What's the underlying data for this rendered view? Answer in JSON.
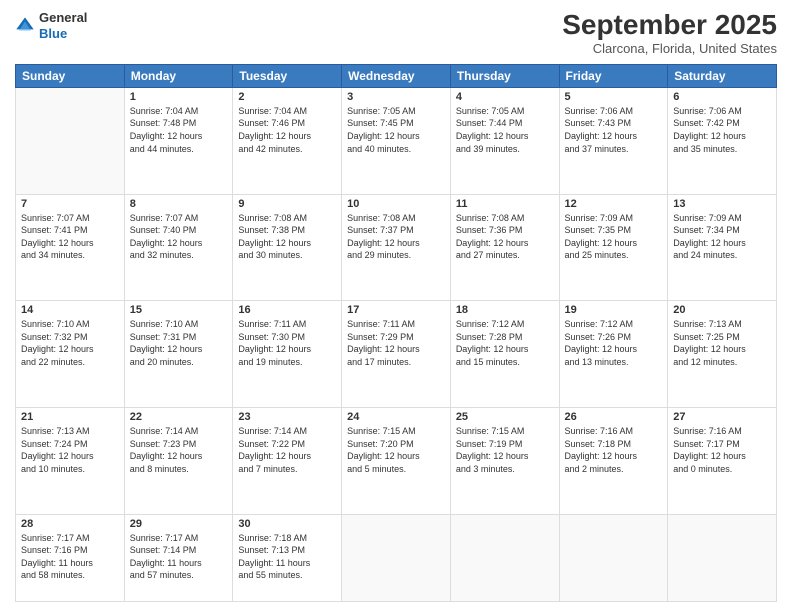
{
  "header": {
    "logo": {
      "general": "General",
      "blue": "Blue"
    },
    "title": "September 2025",
    "location": "Clarcona, Florida, United States"
  },
  "days_of_week": [
    "Sunday",
    "Monday",
    "Tuesday",
    "Wednesday",
    "Thursday",
    "Friday",
    "Saturday"
  ],
  "weeks": [
    [
      {
        "day": "",
        "info": ""
      },
      {
        "day": "1",
        "info": "Sunrise: 7:04 AM\nSunset: 7:48 PM\nDaylight: 12 hours\nand 44 minutes."
      },
      {
        "day": "2",
        "info": "Sunrise: 7:04 AM\nSunset: 7:46 PM\nDaylight: 12 hours\nand 42 minutes."
      },
      {
        "day": "3",
        "info": "Sunrise: 7:05 AM\nSunset: 7:45 PM\nDaylight: 12 hours\nand 40 minutes."
      },
      {
        "day": "4",
        "info": "Sunrise: 7:05 AM\nSunset: 7:44 PM\nDaylight: 12 hours\nand 39 minutes."
      },
      {
        "day": "5",
        "info": "Sunrise: 7:06 AM\nSunset: 7:43 PM\nDaylight: 12 hours\nand 37 minutes."
      },
      {
        "day": "6",
        "info": "Sunrise: 7:06 AM\nSunset: 7:42 PM\nDaylight: 12 hours\nand 35 minutes."
      }
    ],
    [
      {
        "day": "7",
        "info": "Sunrise: 7:07 AM\nSunset: 7:41 PM\nDaylight: 12 hours\nand 34 minutes."
      },
      {
        "day": "8",
        "info": "Sunrise: 7:07 AM\nSunset: 7:40 PM\nDaylight: 12 hours\nand 32 minutes."
      },
      {
        "day": "9",
        "info": "Sunrise: 7:08 AM\nSunset: 7:38 PM\nDaylight: 12 hours\nand 30 minutes."
      },
      {
        "day": "10",
        "info": "Sunrise: 7:08 AM\nSunset: 7:37 PM\nDaylight: 12 hours\nand 29 minutes."
      },
      {
        "day": "11",
        "info": "Sunrise: 7:08 AM\nSunset: 7:36 PM\nDaylight: 12 hours\nand 27 minutes."
      },
      {
        "day": "12",
        "info": "Sunrise: 7:09 AM\nSunset: 7:35 PM\nDaylight: 12 hours\nand 25 minutes."
      },
      {
        "day": "13",
        "info": "Sunrise: 7:09 AM\nSunset: 7:34 PM\nDaylight: 12 hours\nand 24 minutes."
      }
    ],
    [
      {
        "day": "14",
        "info": "Sunrise: 7:10 AM\nSunset: 7:32 PM\nDaylight: 12 hours\nand 22 minutes."
      },
      {
        "day": "15",
        "info": "Sunrise: 7:10 AM\nSunset: 7:31 PM\nDaylight: 12 hours\nand 20 minutes."
      },
      {
        "day": "16",
        "info": "Sunrise: 7:11 AM\nSunset: 7:30 PM\nDaylight: 12 hours\nand 19 minutes."
      },
      {
        "day": "17",
        "info": "Sunrise: 7:11 AM\nSunset: 7:29 PM\nDaylight: 12 hours\nand 17 minutes."
      },
      {
        "day": "18",
        "info": "Sunrise: 7:12 AM\nSunset: 7:28 PM\nDaylight: 12 hours\nand 15 minutes."
      },
      {
        "day": "19",
        "info": "Sunrise: 7:12 AM\nSunset: 7:26 PM\nDaylight: 12 hours\nand 13 minutes."
      },
      {
        "day": "20",
        "info": "Sunrise: 7:13 AM\nSunset: 7:25 PM\nDaylight: 12 hours\nand 12 minutes."
      }
    ],
    [
      {
        "day": "21",
        "info": "Sunrise: 7:13 AM\nSunset: 7:24 PM\nDaylight: 12 hours\nand 10 minutes."
      },
      {
        "day": "22",
        "info": "Sunrise: 7:14 AM\nSunset: 7:23 PM\nDaylight: 12 hours\nand 8 minutes."
      },
      {
        "day": "23",
        "info": "Sunrise: 7:14 AM\nSunset: 7:22 PM\nDaylight: 12 hours\nand 7 minutes."
      },
      {
        "day": "24",
        "info": "Sunrise: 7:15 AM\nSunset: 7:20 PM\nDaylight: 12 hours\nand 5 minutes."
      },
      {
        "day": "25",
        "info": "Sunrise: 7:15 AM\nSunset: 7:19 PM\nDaylight: 12 hours\nand 3 minutes."
      },
      {
        "day": "26",
        "info": "Sunrise: 7:16 AM\nSunset: 7:18 PM\nDaylight: 12 hours\nand 2 minutes."
      },
      {
        "day": "27",
        "info": "Sunrise: 7:16 AM\nSunset: 7:17 PM\nDaylight: 12 hours\nand 0 minutes."
      }
    ],
    [
      {
        "day": "28",
        "info": "Sunrise: 7:17 AM\nSunset: 7:16 PM\nDaylight: 11 hours\nand 58 minutes."
      },
      {
        "day": "29",
        "info": "Sunrise: 7:17 AM\nSunset: 7:14 PM\nDaylight: 11 hours\nand 57 minutes."
      },
      {
        "day": "30",
        "info": "Sunrise: 7:18 AM\nSunset: 7:13 PM\nDaylight: 11 hours\nand 55 minutes."
      },
      {
        "day": "",
        "info": ""
      },
      {
        "day": "",
        "info": ""
      },
      {
        "day": "",
        "info": ""
      },
      {
        "day": "",
        "info": ""
      }
    ]
  ]
}
